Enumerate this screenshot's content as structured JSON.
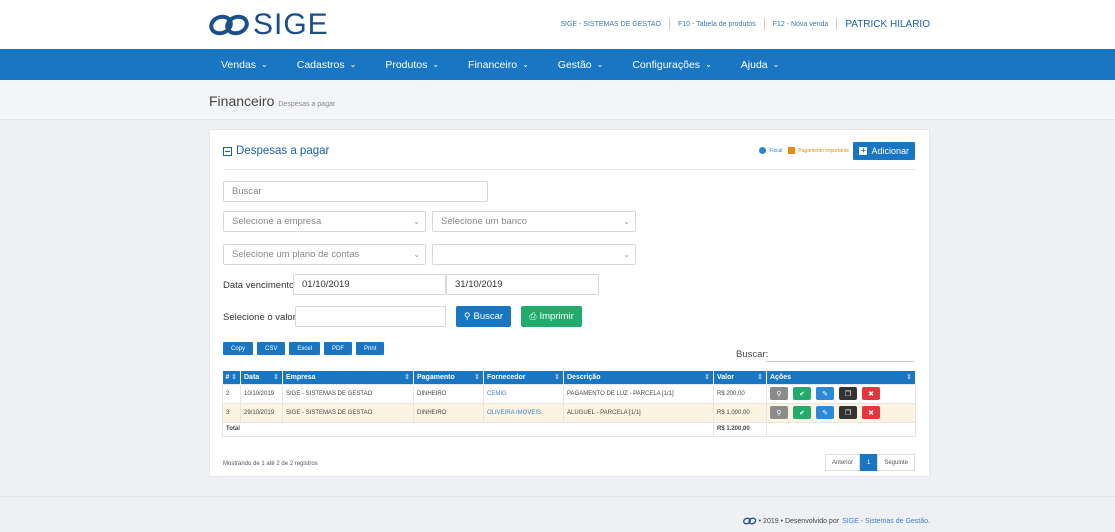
{
  "app": {
    "logo_text": "SIGE"
  },
  "top_links": {
    "company": "SIGE - SISTEMAS DE GESTAO",
    "f10": "F10 - Tabela de produtos",
    "f12": "F12 - Nova venda",
    "user": "PATRICK HILARIO"
  },
  "nav": [
    {
      "label": "Vendas"
    },
    {
      "label": "Cadastros"
    },
    {
      "label": "Produtos"
    },
    {
      "label": "Financeiro"
    },
    {
      "label": "Gestão"
    },
    {
      "label": "Configurações"
    },
    {
      "label": "Ajuda"
    }
  ],
  "page": {
    "title": "Financeiro",
    "subtitle": "Despesas a pagar"
  },
  "panel": {
    "title": "Despesas a pagar",
    "legend_fiscal": "Fiscal",
    "legend_important": "Pagamento importante",
    "add_label": "Adicionar"
  },
  "filters": {
    "search_placeholder": "Buscar",
    "empresa_placeholder": "Selecione a empresa",
    "banco_placeholder": "Selecione um banco",
    "plano_placeholder": "Selecione um plano de contas",
    "data_label": "Data vencimento",
    "date_from": "01/10/2019",
    "date_to": "31/10/2019",
    "valor_label": "Selecione o valor",
    "buscar_label": "Buscar",
    "imprimir_label": "Imprimir"
  },
  "export": [
    "Copy",
    "CSV",
    "Excel",
    "PDF",
    "Print"
  ],
  "table_search_label": "Buscar:",
  "table": {
    "headers": [
      "#",
      "Data",
      "Empresa",
      "Pagamento",
      "Fornecedor",
      "Descrição",
      "Valor",
      "Ações"
    ],
    "rows": [
      {
        "id": "2",
        "data": "10/10/2019",
        "empresa": "SIGE - SISTEMAS DE GESTAO",
        "pagamento": "DINHEIRO",
        "fornecedor": "CEMIG",
        "descricao": "PAGAMENTO DE LUZ - PARCELA [1/1]",
        "valor": "R$ 200,00"
      },
      {
        "id": "3",
        "data": "29/10/2019",
        "empresa": "SIGE - SISTEMAS DE GESTAO",
        "pagamento": "DINHEIRO",
        "fornecedor": "OLIVEIRA IMOVEIS",
        "descricao": "ALUGUEL - PARCELA [1/1]",
        "valor": "R$ 1.000,00"
      }
    ],
    "total_label": "Total",
    "total_value": "R$ 1.200,00"
  },
  "footer_info": "Mostrando de 1 até 2 de 2 registros",
  "pager": {
    "prev": "Anterior",
    "current": "1",
    "next": "Seguinte"
  },
  "bottom": {
    "text": "• 2019 • Desenvolvido por",
    "link": "SIGE - Sistemas de Gestão."
  },
  "colors": {
    "primary": "#1976c2",
    "success": "#21ac6c",
    "danger": "#e3373d",
    "warning": "#e88a16"
  }
}
